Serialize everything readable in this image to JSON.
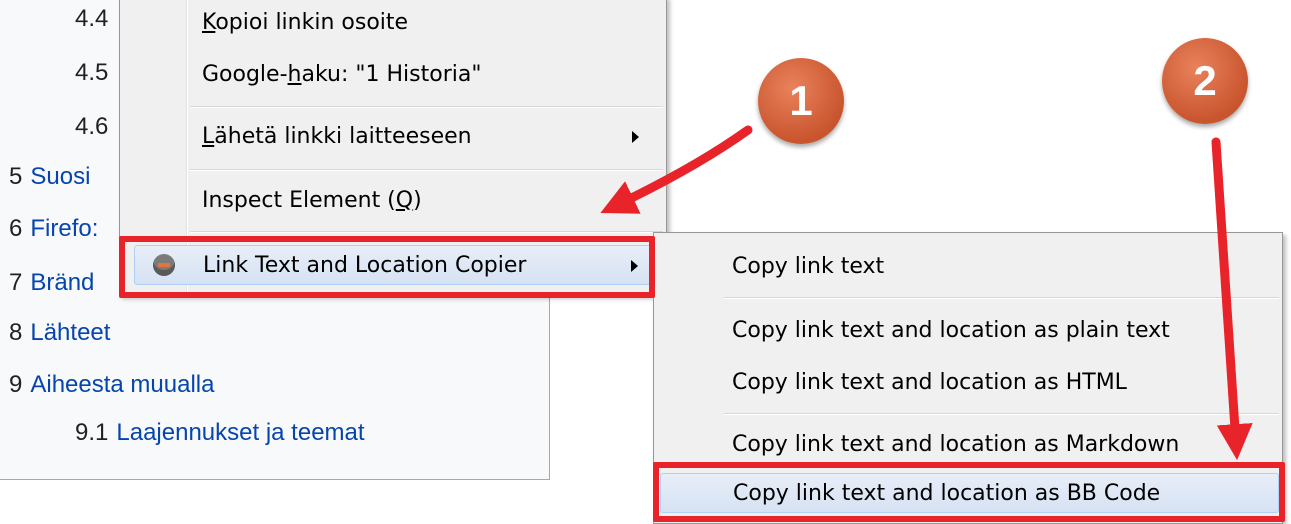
{
  "toc": {
    "rows": [
      {
        "num": "4.4",
        "label": ""
      },
      {
        "num": "4.5",
        "label": ""
      },
      {
        "num": "4.6",
        "label": ""
      },
      {
        "num": "5",
        "label": "Suosi"
      },
      {
        "num": "6",
        "label": "Firefo:"
      },
      {
        "num": "7",
        "label": "Bränd"
      },
      {
        "num": "8",
        "label": "Lähteet"
      },
      {
        "num": "9",
        "label": "Aiheesta muualla"
      },
      {
        "num": "9.1",
        "label": "Laajennukset ja teemat"
      }
    ]
  },
  "context_menu": {
    "copy_link": {
      "pre": "",
      "u": "K",
      "post": "opioi linkin osoite"
    },
    "google_search": {
      "pre": "Google-",
      "u": "h",
      "post": "aku: \"1 Historia\""
    },
    "send_link": {
      "pre": "",
      "u": "L",
      "post": "ähetä linkki laitteeseen"
    },
    "inspect": {
      "pre": "Inspect Element (",
      "u": "Q",
      "post": ")"
    },
    "addon_item": "Link Text and Location Copier"
  },
  "submenu": {
    "items": [
      "Copy link text",
      "Copy link text and location as plain text",
      "Copy link text and location as HTML",
      "Copy link text and location as Markdown",
      "Copy link text and location as BB Code"
    ]
  },
  "callouts": {
    "one": "1",
    "two": "2"
  },
  "colors": {
    "highlight_red": "#e8232a",
    "badge": "#d5643c",
    "link": "#0645ad"
  }
}
